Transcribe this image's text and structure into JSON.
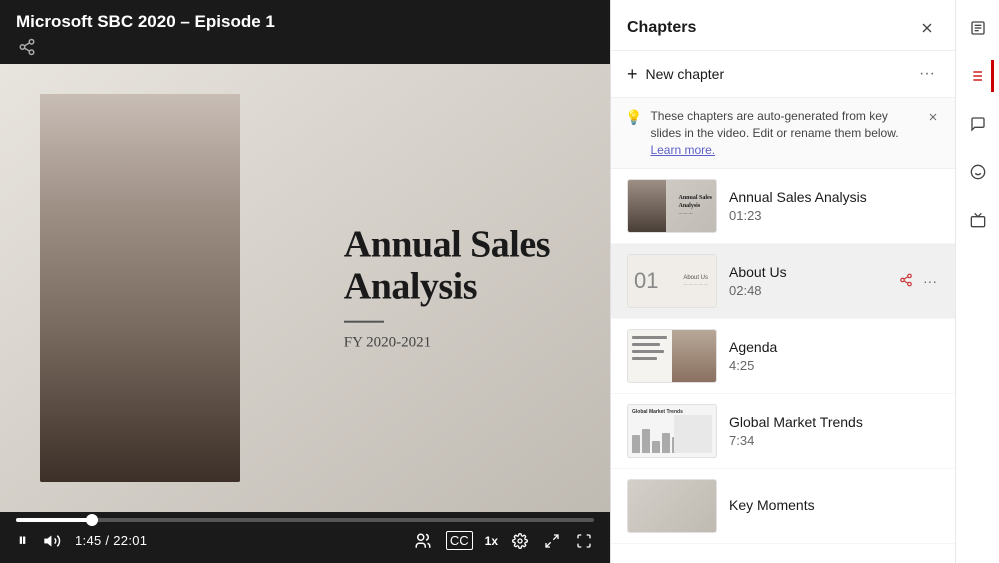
{
  "video": {
    "title": "Microsoft SBC 2020 – Episode 1",
    "time_current": "1:45",
    "time_total": "22:01",
    "progress_percent": 13.2,
    "speed": "1x"
  },
  "slide": {
    "main_title_line1": "Annual Sales",
    "main_title_line2": "Analysis",
    "subtitle": "FY 2020-2021"
  },
  "controls": {
    "play_pause": "⏸",
    "volume": "🔊",
    "captions": "CC",
    "speed": "1x",
    "pip": "⧉",
    "settings": "⚙",
    "fullscreen": "⛶",
    "cast": "📺"
  },
  "chapters": {
    "panel_title": "Chapters",
    "new_chapter_label": "New chapter",
    "banner_text": "These chapters are auto-generated from key slides in the video. Edit or rename them below.",
    "banner_link": "Learn more.",
    "items": [
      {
        "name": "Annual Sales Analysis",
        "time": "01:23",
        "active": false
      },
      {
        "name": "About Us",
        "time": "02:48",
        "active": true
      },
      {
        "name": "Agenda",
        "time": "4:25",
        "active": false
      },
      {
        "name": "Global Market Trends",
        "time": "7:34",
        "active": false
      },
      {
        "name": "Key Moments",
        "time": "",
        "active": false
      }
    ]
  },
  "right_sidebar": {
    "icons": [
      "transcript",
      "chapters",
      "comments",
      "reactions",
      "clips"
    ]
  }
}
